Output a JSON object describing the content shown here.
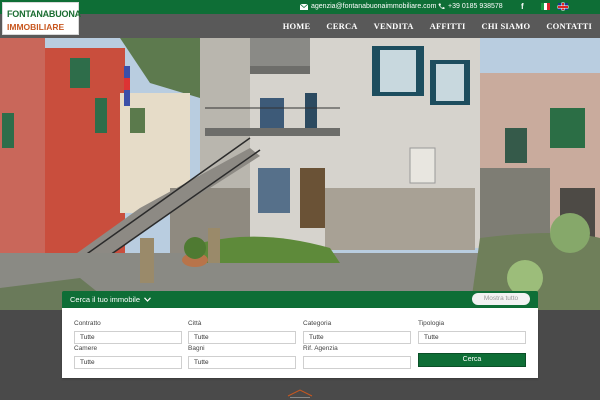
{
  "topbar": {
    "email": "agenzia@fontanabuonaimmobiliare.com",
    "phone": "+39 0185 938578",
    "social": "facebook-icon",
    "lang_it": "italian-flag-icon",
    "lang_en": "english-flag-icon"
  },
  "logo": {
    "line1": "FONTANABUONA",
    "line2": "IMMOBILIARE"
  },
  "nav": {
    "items": [
      "HOME",
      "CERCA",
      "VENDITA",
      "AFFITTI",
      "CHI SIAMO",
      "CONTATTI"
    ]
  },
  "search": {
    "title": "Cerca il tuo immobile",
    "show_all": "Mostra tutto",
    "fields": [
      {
        "label": "Contratto",
        "value": "Tutte"
      },
      {
        "label": "Città",
        "value": "Tutte"
      },
      {
        "label": "Categoria",
        "value": "Tutte"
      },
      {
        "label": "Tipologia",
        "value": "Tutte"
      },
      {
        "label": "Camere",
        "value": "Tutte"
      },
      {
        "label": "Bagni",
        "value": "Tutte"
      },
      {
        "label": "Rif. Agenzia",
        "value": ""
      }
    ],
    "button": "Cerca"
  },
  "colors": {
    "brand_green": "#0e6e36",
    "accent_orange": "#c8571f",
    "nav_bg": "#595959"
  }
}
